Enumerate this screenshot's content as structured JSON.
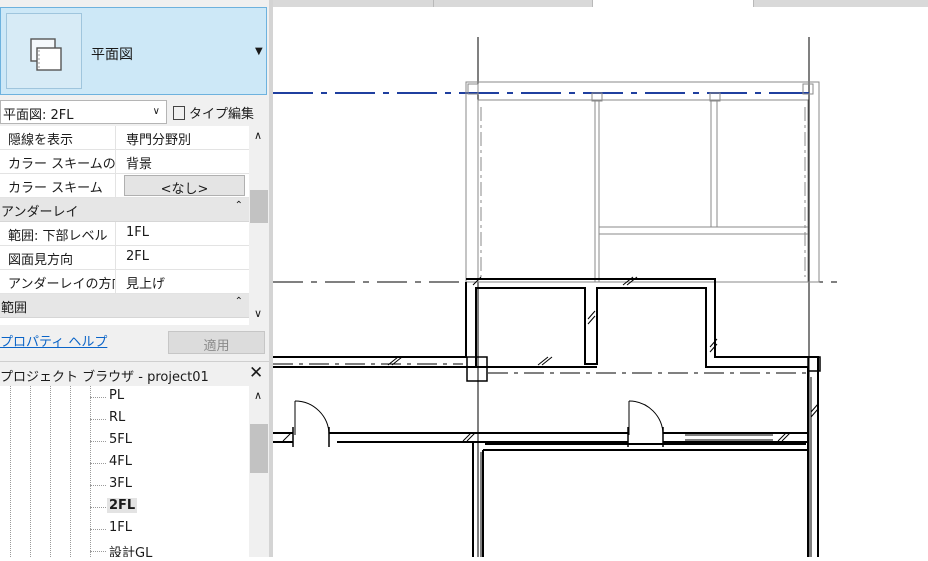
{
  "properties": {
    "type_name": "平面図",
    "view_selector": "平面図: 2FL",
    "edit_type_label": "タイプ編集",
    "rows": [
      {
        "kind": "prop",
        "name": "隠線を表示",
        "value": "専門分野別"
      },
      {
        "kind": "prop",
        "name": "カラー スキームの...",
        "value": "背景"
      },
      {
        "kind": "prop",
        "name": "カラー スキーム",
        "value": "<なし>",
        "button": true
      },
      {
        "kind": "group",
        "name": "アンダーレイ"
      },
      {
        "kind": "prop",
        "name": "範囲: 下部レベル",
        "value": "1FL"
      },
      {
        "kind": "prop",
        "name": "図面見方向",
        "value": "2FL"
      },
      {
        "kind": "prop",
        "name": "アンダーレイの方向",
        "value": "見上げ"
      },
      {
        "kind": "group",
        "name": "範囲"
      }
    ],
    "help_link": "プロパティ ヘルプ",
    "apply_button": "適用"
  },
  "project_browser": {
    "title": "プロジェクト ブラウザ - project01",
    "items": [
      "PL",
      "RL",
      "5FL",
      "4FL",
      "3FL",
      "2FL",
      "1FL",
      "設計GL"
    ],
    "selected_index": 5
  },
  "colors": {
    "accent_panel": "#cde8f7",
    "link": "#0a64c8",
    "reference_line": "#1f3f9f"
  }
}
